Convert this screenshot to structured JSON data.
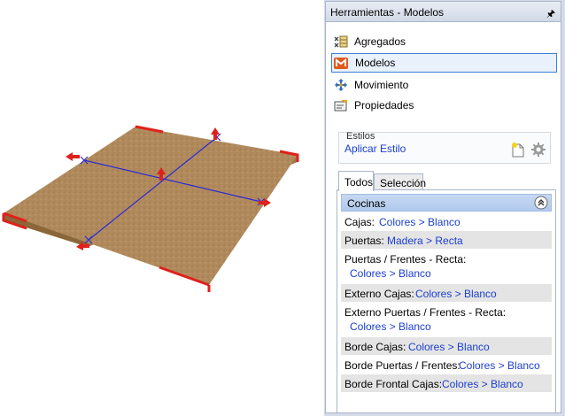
{
  "panel": {
    "title": "Herramientas - Modelos",
    "pin_icon": "pin-icon",
    "nav": [
      {
        "label": "Agregados",
        "icon": "agregados-icon"
      },
      {
        "label": "Modelos",
        "icon": "modelos-icon",
        "active": true
      },
      {
        "label": "Movimiento",
        "icon": "move-icon"
      },
      {
        "label": "Propiedades",
        "icon": "properties-icon"
      }
    ],
    "estilos": {
      "title": "Estilos",
      "link": "Aplicar Estilo",
      "new_icon": "new-style-icon",
      "gear_icon": "gear-icon"
    },
    "tabs": [
      {
        "label": "Todos",
        "selected": true
      },
      {
        "label": "Selección",
        "selected": false
      }
    ],
    "group": {
      "label": "Cocinas",
      "collapse_icon": "collapse-up-icon"
    },
    "properties": [
      {
        "key": "Cajas:",
        "value": "Colores > Blanco"
      },
      {
        "key": "Puertas:",
        "value": "Madera > Recta"
      },
      {
        "key": "Puertas / Frentes - Recta:",
        "value": "Colores > Blanco"
      },
      {
        "key": "Externo Cajas:",
        "value": "Colores > Blanco"
      },
      {
        "key": "Externo Puertas / Frentes - Recta:",
        "value": "Colores > Blanco"
      },
      {
        "key": "Borde Cajas:",
        "value": "Colores > Blanco"
      },
      {
        "key": "Borde Puertas / Frentes:",
        "value": "Colores > Blanco"
      },
      {
        "key": "Borde Frontal Cajas:",
        "value": "Colores > Blanco"
      }
    ]
  },
  "viewport": {
    "object": "wood-board",
    "colors": {
      "wood": "#b08a5c",
      "edge": "#e0201b",
      "axis": "#2a2ad8",
      "background": "#ffffff"
    }
  }
}
